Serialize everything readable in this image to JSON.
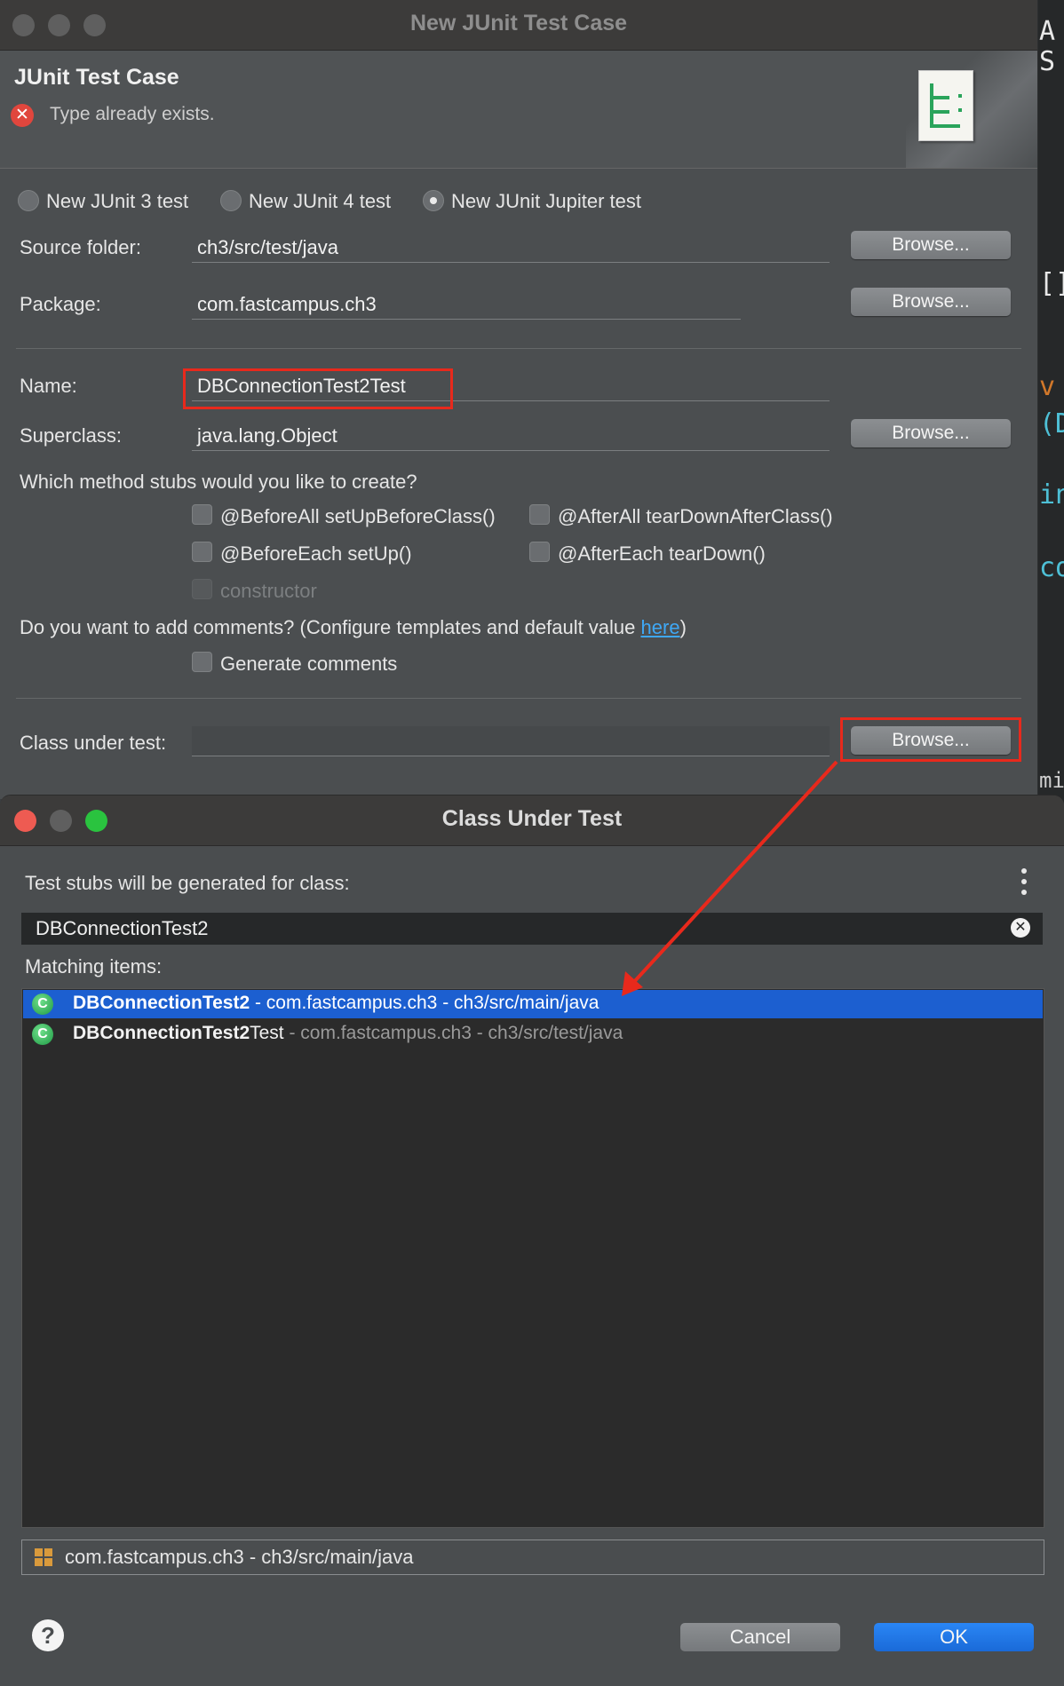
{
  "background_editor": {
    "fragments": [
      "A",
      "S",
      "[]",
      "v",
      "(D",
      "in",
      "co",
      "mir"
    ]
  },
  "main_dialog": {
    "title": "New JUnit Test Case",
    "header_title": "JUnit Test Case",
    "error_message": "Type already exists.",
    "junit_versions": [
      {
        "label": "New JUnit 3 test",
        "selected": false
      },
      {
        "label": "New JUnit 4 test",
        "selected": false
      },
      {
        "label": "New JUnit Jupiter test",
        "selected": true
      }
    ],
    "source_folder": {
      "label": "Source folder:",
      "value": "ch3/src/test/java",
      "browse": "Browse..."
    },
    "package": {
      "label": "Package:",
      "value": "com.fastcampus.ch3",
      "browse": "Browse..."
    },
    "name": {
      "label": "Name:",
      "value": "DBConnectionTest2Test"
    },
    "superclass": {
      "label": "Superclass:",
      "value": "java.lang.Object",
      "browse": "Browse..."
    },
    "stubs_question": "Which method stubs would you like to create?",
    "stubs": [
      {
        "label": "@BeforeAll setUpBeforeClass()",
        "checked": false
      },
      {
        "label": "@AfterAll tearDownAfterClass()",
        "checked": false
      },
      {
        "label": "@BeforeEach setUp()",
        "checked": false
      },
      {
        "label": "@AfterEach tearDown()",
        "checked": false
      },
      {
        "label": "constructor",
        "checked": false,
        "disabled": true
      }
    ],
    "comments_question_prefix": "Do you want to add comments? (Configure templates and default value ",
    "comments_question_link": "here",
    "comments_question_suffix": ")",
    "generate_comments": "Generate comments",
    "class_under_test": {
      "label": "Class under test:",
      "value": "",
      "browse": "Browse..."
    }
  },
  "class_dialog": {
    "title": "Class Under Test",
    "prompt": "Test stubs will be generated for class:",
    "search_value": "DBConnectionTest2",
    "matching_label": "Matching items:",
    "items": [
      {
        "name": "DBConnectionTest2",
        "name_suffix": "",
        "detail": " - com.fastcampus.ch3 - ch3/src/main/java",
        "selected": true
      },
      {
        "name": "DBConnectionTest2",
        "name_suffix": "Test",
        "detail": " - com.fastcampus.ch3 - ch3/src/test/java",
        "selected": false
      }
    ],
    "package_location": "com.fastcampus.ch3 - ch3/src/main/java",
    "cancel": "Cancel",
    "ok": "OK"
  },
  "colors": {
    "highlight": "#e8291c",
    "selection": "#1c5fd0",
    "ok_button": "#1a6ad8",
    "link": "#3fa8f5"
  }
}
